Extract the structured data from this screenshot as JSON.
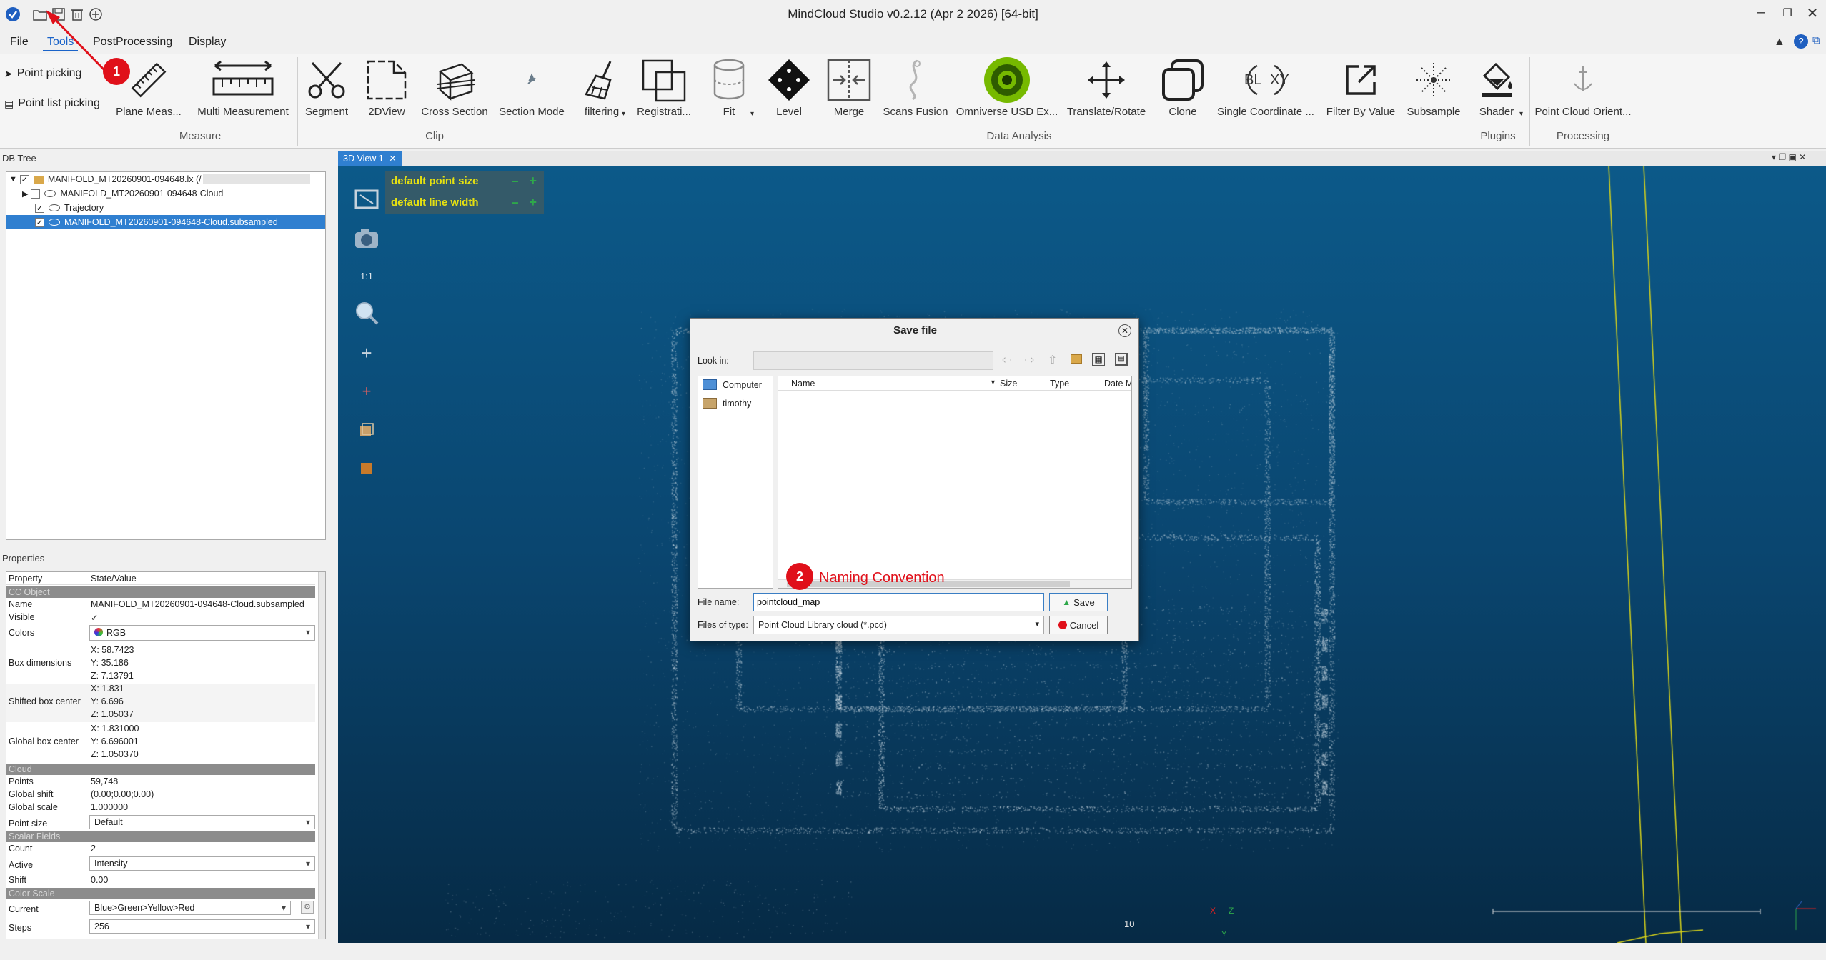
{
  "app": {
    "title": "MindCloud Studio v0.2.12 (Apr  2 2026) [64-bit]",
    "window_controls": [
      "minimize-icon",
      "restore-icon",
      "close-icon"
    ]
  },
  "menu": [
    "File",
    "Tools",
    "PostProcessing",
    "Display"
  ],
  "ribbon": {
    "picking": [
      "Point picking",
      "Point list picking"
    ],
    "tools": [
      {
        "label": "Plane Meas...",
        "icon": "ruler-icon"
      },
      {
        "label": "Multi Measurement",
        "icon": "multi-ruler-icon"
      },
      {
        "label": "Segment",
        "icon": "scissors-icon"
      },
      {
        "label": "2DView",
        "icon": "2dview-icon"
      },
      {
        "label": "Cross Section",
        "icon": "cross-section-icon"
      },
      {
        "label": "Section Mode",
        "icon": "section-mode-icon"
      },
      {
        "label": "filtering",
        "icon": "broom-icon"
      },
      {
        "label": "Registrati...",
        "icon": "registration-icon"
      },
      {
        "label": "Fit",
        "icon": "cylinder-icon"
      },
      {
        "label": "Level",
        "icon": "level-icon"
      },
      {
        "label": "Merge",
        "icon": "merge-icon"
      },
      {
        "label": "Scans Fusion",
        "icon": "fusion-icon"
      },
      {
        "label": "Omniverse USD Ex...",
        "icon": "omniverse-icon"
      },
      {
        "label": "Translate/Rotate",
        "icon": "move-icon"
      },
      {
        "label": "Clone",
        "icon": "clone-icon"
      },
      {
        "label": "Single Coordinate ...",
        "icon": "coordinate-icon"
      },
      {
        "label": "Filter By Value",
        "icon": "export-icon"
      },
      {
        "label": "Subsample",
        "icon": "subsample-icon"
      },
      {
        "label": "Shader",
        "icon": "paint-bucket-icon"
      },
      {
        "label": "Point Cloud Orient...",
        "icon": "anchor-icon"
      }
    ],
    "groups": [
      "Measure",
      "Clip",
      "Data Analysis",
      "Plugins",
      "Processing"
    ]
  },
  "db_tree": {
    "title": "DB Tree",
    "root": "MANIFOLD_MT20260901-094648.lx (/",
    "children": [
      "MANIFOLD_MT20260901-094648-Cloud",
      "Trajectory",
      "MANIFOLD_MT20260901-094648-Cloud.subsampled"
    ]
  },
  "properties": {
    "title": "Properties",
    "headers": [
      "Property",
      "State/Value"
    ],
    "sections": [
      "CC Object",
      "Cloud",
      "Scalar Fields",
      "Color Scale"
    ],
    "name": "MANIFOLD_MT20260901-094648-Cloud.subsampled",
    "visible": "✓",
    "colors": "RGB",
    "box_dimensions": [
      "X: 58.7423",
      "Y: 35.186",
      "Z: 7.13791"
    ],
    "shifted_box_center": [
      "X: 1.831",
      "Y: 6.696",
      "Z: 1.05037"
    ],
    "global_box_center": [
      "X: 1.831000",
      "Y: 6.696001",
      "Z: 1.050370"
    ],
    "points": "59,748",
    "global_shift": "(0.00;0.00;0.00)",
    "global_scale": "1.000000",
    "point_size": "Default",
    "count": "2",
    "active": "Intensity",
    "shift": "0.00",
    "current": "Blue>Green>Yellow>Red",
    "steps": "256",
    "labels": {
      "name": "Name",
      "visible": "Visible",
      "colors": "Colors",
      "box_dimensions": "Box dimensions",
      "shifted_box_center": "Shifted box center",
      "global_box_center": "Global box center",
      "points": "Points",
      "global_shift": "Global shift",
      "global_scale": "Global scale",
      "point_size": "Point size",
      "count": "Count",
      "active": "Active",
      "shift": "Shift",
      "current": "Current",
      "steps": "Steps"
    }
  },
  "view": {
    "tab": "3D View 1",
    "overlay": [
      "default point size",
      "default line width"
    ],
    "overlay_controls": [
      "–",
      "+"
    ],
    "side_label": "1:1",
    "scale_label": "10",
    "axis_labels": [
      "X",
      "Z",
      "Y"
    ]
  },
  "dialog": {
    "title": "Save file",
    "look_in_label": "Look in:",
    "places": [
      "Computer",
      "timothy"
    ],
    "columns": [
      "Name",
      "Size",
      "Type",
      "Date Mo"
    ],
    "file_name_label": "File name:",
    "file_name_value": "pointcloud_map",
    "files_of_type_label": "Files of type:",
    "files_of_type_value": "Point Cloud Library cloud (*.pcd)",
    "save_label": "Save",
    "cancel_label": "Cancel"
  },
  "annotations": [
    {
      "number": "1",
      "text": ""
    },
    {
      "number": "2",
      "text": "Naming Convention"
    }
  ],
  "colors": {
    "accent": "#1a63c9",
    "annotation": "#e0101a",
    "selection": "#2f7fd0",
    "overlay_text": "#e5e011"
  }
}
